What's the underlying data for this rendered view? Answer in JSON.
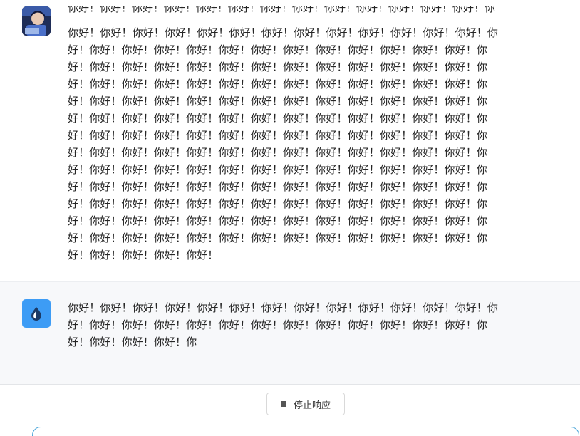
{
  "user_message": {
    "avatar": "user-avatar-photo",
    "clipped_top_line": "你好！你好！你好！你好！你好！你好！你好！你好！你好！你好！你好！你好！你好！你",
    "text": "你好！你好！你好！你好！你好！你好！你好！你好！你好！你好！你好！你好！你好！你\n好！你好！你好！你好！你好！你好！你好！你好！你好！你好！你好！你好！你好！你\n好！你好！你好！你好！你好！你好！你好！你好！你好！你好！你好！你好！你好！你\n好！你好！你好！你好！你好！你好！你好！你好！你好！你好！你好！你好！你好！你\n好！你好！你好！你好！你好！你好！你好！你好！你好！你好！你好！你好！你好！你\n好！你好！你好！你好！你好！你好！你好！你好！你好！你好！你好！你好！你好！你\n好！你好！你好！你好！你好！你好！你好！你好！你好！你好！你好！你好！你好！你\n好！你好！你好！你好！你好！你好！你好！你好！你好！你好！你好！你好！你好！你\n好！你好！你好！你好！你好！你好！你好！你好！你好！你好！你好！你好！你好！你\n好！你好！你好！你好！你好！你好！你好！你好！你好！你好！你好！你好！你好！你\n好！你好！你好！你好！你好！你好！你好！你好！你好！你好！你好！你好！你好！你\n好！你好！你好！你好！你好！你好！你好！你好！你好！你好！你好！你好！你好！你\n好！你好！你好！你好！你好！你好！你好！你好！你好！你好！你好！你好！你好！你\n好！你好！你好！你好！你好！"
  },
  "assistant_message": {
    "avatar": "drop-logo-icon",
    "text": "你好！你好！你好！你好！你好！你好！你好！你好！你好！你好！你好！你好！你好！你\n好！你好！你好！你好！你好！你好！你好！你好！你好！你好！你好！你好！你好！你\n好！你好！你好！你好！你"
  },
  "controls": {
    "stop_label": "停止响应",
    "stop_icon": "stop-square-icon"
  },
  "colors": {
    "accent": "#3d9cf5",
    "assistant_bg": "#f7f8fa",
    "input_border": "#4aa5d9"
  }
}
